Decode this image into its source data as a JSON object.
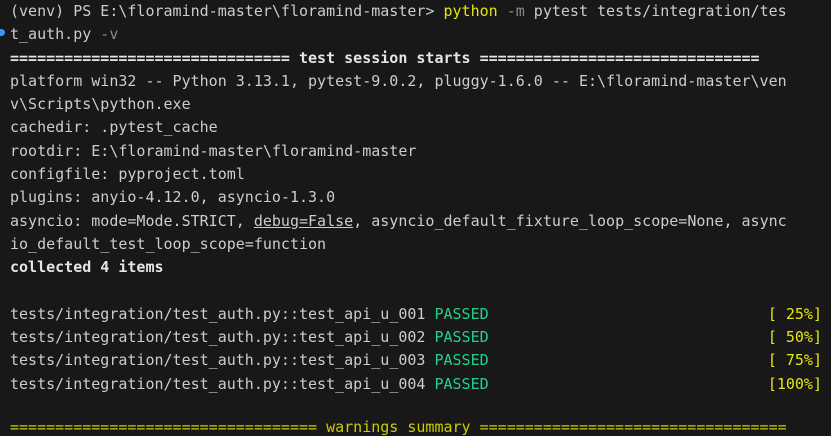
{
  "prompt": {
    "venv": "(venv)",
    "ps": " PS E:\\floramind-master\\floramind-master> ",
    "command": "python",
    "flag": " -m ",
    "args": "pytest tests/integration/tes",
    "wrap": "t_auth.py",
    "verbose": " -v"
  },
  "session_header": "=============================== test session starts ===============================",
  "info_lines": [
    "platform win32 -- Python 3.13.1, pytest-9.0.2, pluggy-1.6.0 -- E:\\floramind-master\\ven",
    "v\\Scripts\\python.exe",
    "cachedir: .pytest_cache",
    "rootdir: E:\\floramind-master\\floramind-master",
    "configfile: pyproject.toml",
    "plugins: anyio-4.12.0, asyncio-1.3.0"
  ],
  "asyncio": {
    "prefix": "asyncio: mode=Mode.STRICT, ",
    "debug": "debug=False",
    "suffix": ", asyncio_default_fixture_loop_scope=None, async",
    "wrap": "io_default_test_loop_scope=function"
  },
  "collected": "collected 4 items",
  "tests": [
    {
      "name": "tests/integration/test_auth.py::test_api_u_001",
      "status": "PASSED",
      "progress": "[ 25%]"
    },
    {
      "name": "tests/integration/test_auth.py::test_api_u_002",
      "status": "PASSED",
      "progress": "[ 50%]"
    },
    {
      "name": "tests/integration/test_auth.py::test_api_u_003",
      "status": "PASSED",
      "progress": "[ 75%]"
    },
    {
      "name": "tests/integration/test_auth.py::test_api_u_004",
      "status": "PASSED",
      "progress": "[100%]"
    }
  ],
  "warnings_header": "================================== warnings summary ==================================",
  "colors": {
    "background": "#181818",
    "text": "#cccccc",
    "command": "#e5e510",
    "passed": "#23d18b",
    "progress": "#e5e510"
  }
}
